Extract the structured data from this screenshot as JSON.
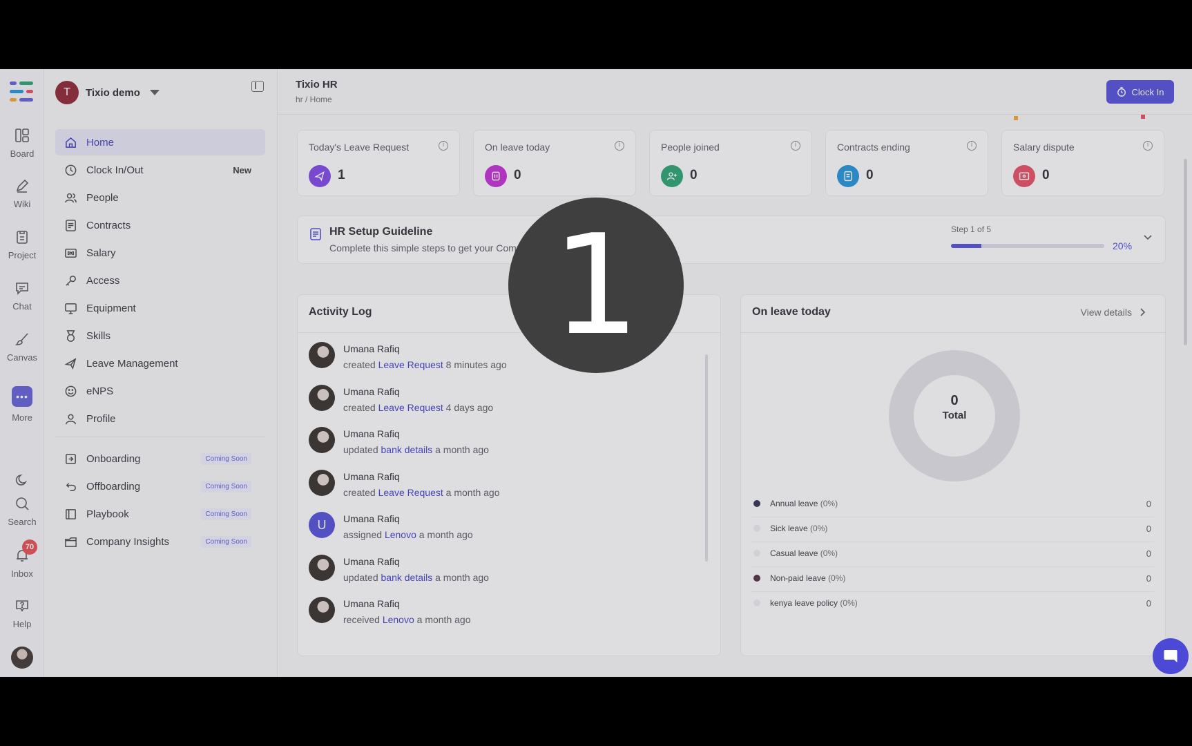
{
  "app": {
    "title": "Tixio HR",
    "breadcrumb": "hr / Home"
  },
  "workspace": {
    "initial": "T",
    "name": "Tixio demo"
  },
  "rail": {
    "items": [
      {
        "label": "Board",
        "icon": "board-icon"
      },
      {
        "label": "Wiki",
        "icon": "pencil-icon"
      },
      {
        "label": "Project",
        "icon": "clipboard-icon"
      },
      {
        "label": "Chat",
        "icon": "chat-icon"
      },
      {
        "label": "Canvas",
        "icon": "brush-icon"
      },
      {
        "label": "More",
        "icon": "more-icon"
      }
    ],
    "search_label": "Search",
    "inbox_label": "Inbox",
    "inbox_badge": "70",
    "help_label": "Help"
  },
  "nav": {
    "items": [
      {
        "label": "Home",
        "icon": "home-icon"
      },
      {
        "label": "Clock In/Out",
        "icon": "clock-icon",
        "tag": "New"
      },
      {
        "label": "People",
        "icon": "people-icon"
      },
      {
        "label": "Contracts",
        "icon": "contract-icon"
      },
      {
        "label": "Salary",
        "icon": "salary-icon"
      },
      {
        "label": "Access",
        "icon": "key-icon"
      },
      {
        "label": "Equipment",
        "icon": "monitor-icon"
      },
      {
        "label": "Skills",
        "icon": "skills-icon"
      },
      {
        "label": "Leave Management",
        "icon": "plane-icon"
      },
      {
        "label": "eNPS",
        "icon": "smile-icon"
      },
      {
        "label": "Profile",
        "icon": "user-icon"
      }
    ],
    "coming": [
      {
        "label": "Onboarding",
        "tag": "Coming Soon",
        "icon": "enter-icon"
      },
      {
        "label": "Offboarding",
        "tag": "Coming Soon",
        "icon": "undo-icon"
      },
      {
        "label": "Playbook",
        "tag": "Coming Soon",
        "icon": "book-icon"
      },
      {
        "label": "Company Insights",
        "tag": "Coming Soon",
        "icon": "folder-icon"
      }
    ]
  },
  "topbar": {
    "clock_in_label": "Clock In"
  },
  "stats": [
    {
      "title": "Today's Leave Request",
      "value": "1",
      "color": "#7b3fe4"
    },
    {
      "title": "On leave today",
      "value": "0",
      "color": "#c026d3"
    },
    {
      "title": "People joined",
      "value": "0",
      "color": "#22a06b"
    },
    {
      "title": "Contracts ending",
      "value": "0",
      "color": "#1c8fd6"
    },
    {
      "title": "Salary dispute",
      "value": "0",
      "color": "#e5485f"
    }
  ],
  "setup": {
    "title": "HR Setup Guideline",
    "subtitle": "Complete this simple steps to get your Company HR setup",
    "step": "Step 1 of 5",
    "progress_percent": 20,
    "progress_label": "20%"
  },
  "activity": {
    "title": "Activity Log",
    "entries": [
      {
        "name": "Umana Rafiq",
        "verb": "created",
        "link": "Leave Request",
        "time": "8 minutes ago"
      },
      {
        "name": "Umana Rafiq",
        "verb": "created",
        "link": "Leave Request",
        "time": "4 days ago"
      },
      {
        "name": "Umana Rafiq",
        "verb": "updated",
        "link": "bank details",
        "time": "a month ago"
      },
      {
        "name": "Umana Rafiq",
        "verb": "created",
        "link": "Leave Request",
        "time": "a month ago"
      },
      {
        "name": "Umana Rafiq",
        "verb": "assigned",
        "link": "Lenovo",
        "time": "a month ago",
        "avatar_initial": "U"
      },
      {
        "name": "Umana Rafiq",
        "verb": "updated",
        "link": "bank details",
        "time": "a month ago"
      },
      {
        "name": "Umana Rafiq",
        "verb": "received",
        "link": "Lenovo",
        "time": "a month ago"
      }
    ]
  },
  "leave": {
    "title": "On leave today",
    "view_details": "View details",
    "total_value": "0",
    "total_label": "Total",
    "legend": [
      {
        "label": "Annual leave",
        "pct": "(0%)",
        "value": "0",
        "color": "#2a2a4a"
      },
      {
        "label": "Sick leave",
        "pct": "(0%)",
        "value": "0",
        "color": "#e9e9ee"
      },
      {
        "label": "Casual leave",
        "pct": "(0%)",
        "value": "0",
        "color": "#e9e9ee"
      },
      {
        "label": "Non-paid leave",
        "pct": "(0%)",
        "value": "0",
        "color": "#4a2a3a"
      },
      {
        "label": "kenya leave policy",
        "pct": "(0%)",
        "value": "0",
        "color": "#e9e9ee"
      }
    ]
  },
  "overlay": {
    "step_number": "1"
  }
}
